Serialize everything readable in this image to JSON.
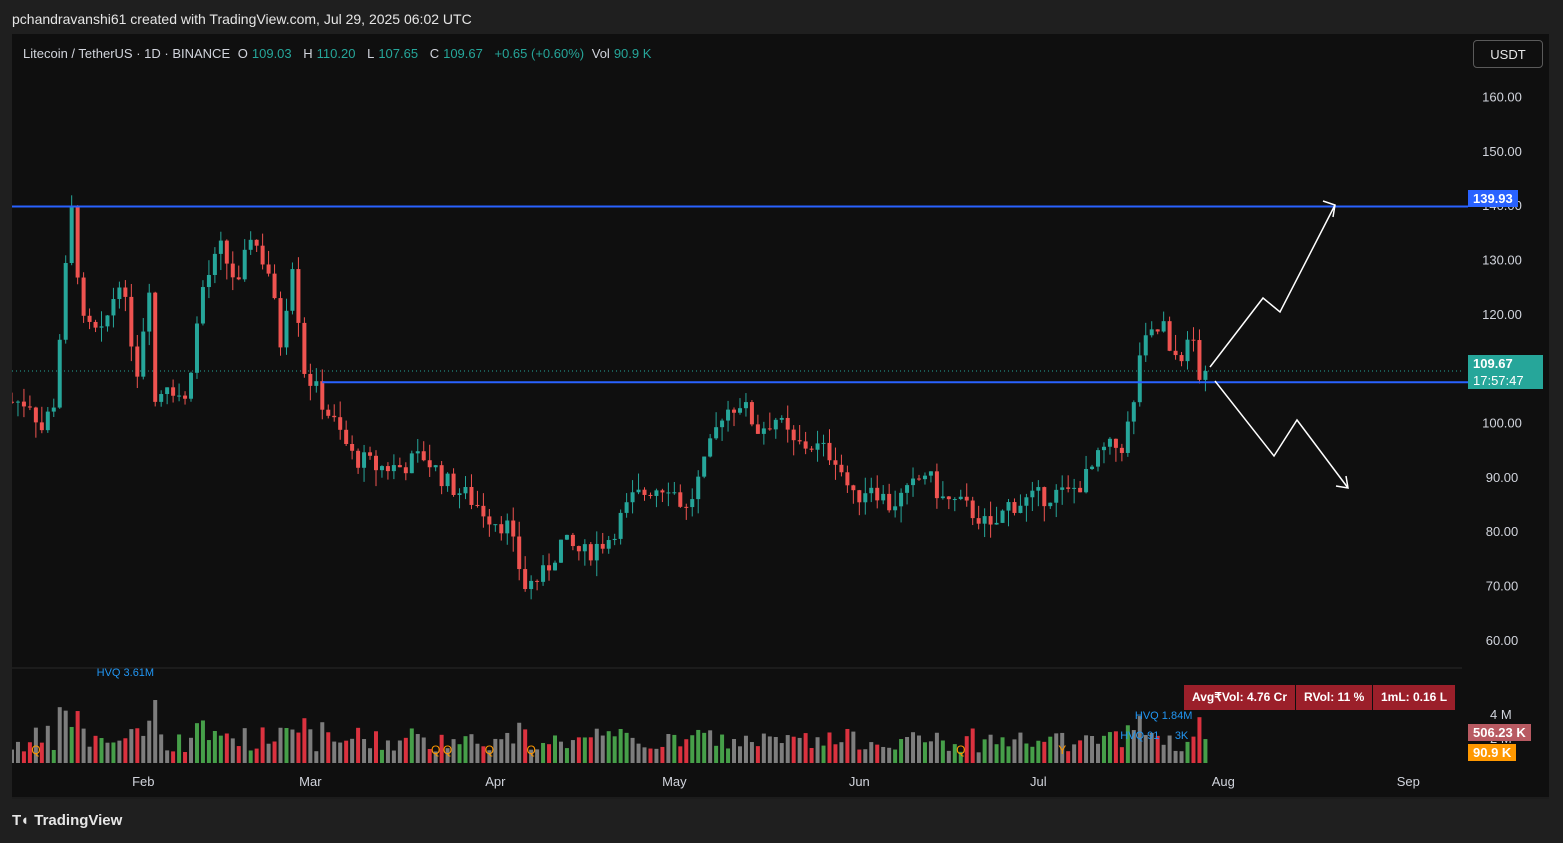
{
  "snapshot": {
    "author_line": "pchandravanshi61 created with TradingView.com, Jul 29, 2025 06:02 UTC"
  },
  "legend": {
    "symbol": "Litecoin / TetherUS · 1D · BINANCE",
    "open_label": "O",
    "open": "109.03",
    "high_label": "H",
    "high": "110.20",
    "low_label": "L",
    "low": "107.65",
    "close_label": "C",
    "close": "109.67",
    "change": "+0.65 (+0.60%)",
    "vol_label": "Vol",
    "vol": "90.9 K"
  },
  "currency": "USDT",
  "price_tags": {
    "resistance": "139.93",
    "last_price": "109.67",
    "countdown": "17:57:47",
    "vol_ma": "506.23 K",
    "vol_current": "90.9 K"
  },
  "volume_stats": {
    "avg_vol": "Avg₹Vol: 4.76 Cr",
    "rvol": "RVol: 11 %",
    "iml": "1mL: 0.16 L"
  },
  "footer": {
    "brand": "TradingView"
  },
  "colors": {
    "up": "#26a69a",
    "down": "#ef5350",
    "level": "#2962ff",
    "vol_up": "#4caf50",
    "vol_down": "#f23645",
    "vol_neutral": "#8a8a8a",
    "vol_hv": "#2196f3",
    "vol_q": "#ff9800"
  },
  "chart_data": {
    "type": "candlestick",
    "y_range": [
      55,
      168
    ],
    "x_range": [
      "2025-01-10",
      "2025-09-10"
    ],
    "y_ticks": [
      "160.00",
      "150.00",
      "140.00",
      "130.00",
      "120.00",
      "110.00",
      "100.00",
      "90.00",
      "80.00",
      "70.00",
      "60.00"
    ],
    "y_tick_values": [
      160,
      150,
      140,
      130,
      120,
      110,
      100,
      90,
      80,
      70,
      60
    ],
    "x_ticks": [
      {
        "label": "Feb",
        "date": "2025-02-01"
      },
      {
        "label": "Mar",
        "date": "2025-03-01"
      },
      {
        "label": "Apr",
        "date": "2025-04-01"
      },
      {
        "label": "May",
        "date": "2025-05-01"
      },
      {
        "label": "Jun",
        "date": "2025-06-01"
      },
      {
        "label": "Jul",
        "date": "2025-07-01"
      },
      {
        "label": "Aug",
        "date": "2025-08-01"
      },
      {
        "label": "Sep",
        "date": "2025-09-01"
      }
    ],
    "volume_axis_ticks": [
      "4 M",
      "2 M"
    ],
    "volume_axis_values": [
      4,
      2
    ],
    "close_path": [
      {
        "date": "2025-01-10",
        "close": 104
      },
      {
        "date": "2025-01-13",
        "close": 104
      },
      {
        "date": "2025-01-15",
        "close": 99
      },
      {
        "date": "2025-01-17",
        "close": 104
      },
      {
        "date": "2025-01-19",
        "close": 128
      },
      {
        "date": "2025-01-20",
        "close": 139
      },
      {
        "date": "2025-01-22",
        "close": 118
      },
      {
        "date": "2025-01-25",
        "close": 116
      },
      {
        "date": "2025-01-28",
        "close": 127
      },
      {
        "date": "2025-01-31",
        "close": 110
      },
      {
        "date": "2025-02-02",
        "close": 126
      },
      {
        "date": "2025-02-03",
        "close": 104
      },
      {
        "date": "2025-02-05",
        "close": 108
      },
      {
        "date": "2025-02-08",
        "close": 104
      },
      {
        "date": "2025-02-11",
        "close": 125
      },
      {
        "date": "2025-02-14",
        "close": 132
      },
      {
        "date": "2025-02-17",
        "close": 125
      },
      {
        "date": "2025-02-19",
        "close": 135
      },
      {
        "date": "2025-02-22",
        "close": 128
      },
      {
        "date": "2025-02-24",
        "close": 115
      },
      {
        "date": "2025-02-26",
        "close": 130
      },
      {
        "date": "2025-02-28",
        "close": 110
      },
      {
        "date": "2025-03-03",
        "close": 104
      },
      {
        "date": "2025-03-05",
        "close": 100
      },
      {
        "date": "2025-03-08",
        "close": 94
      },
      {
        "date": "2025-03-12",
        "close": 92
      },
      {
        "date": "2025-03-16",
        "close": 92
      },
      {
        "date": "2025-03-20",
        "close": 94
      },
      {
        "date": "2025-03-24",
        "close": 89
      },
      {
        "date": "2025-03-28",
        "close": 86
      },
      {
        "date": "2025-03-31",
        "close": 83
      },
      {
        "date": "2025-04-03",
        "close": 81
      },
      {
        "date": "2025-04-06",
        "close": 70
      },
      {
        "date": "2025-04-09",
        "close": 72
      },
      {
        "date": "2025-04-12",
        "close": 78
      },
      {
        "date": "2025-04-16",
        "close": 76
      },
      {
        "date": "2025-04-20",
        "close": 79
      },
      {
        "date": "2025-04-24",
        "close": 86
      },
      {
        "date": "2025-04-27",
        "close": 88
      },
      {
        "date": "2025-04-30",
        "close": 89
      },
      {
        "date": "2025-05-03",
        "close": 84
      },
      {
        "date": "2025-05-06",
        "close": 92
      },
      {
        "date": "2025-05-09",
        "close": 102
      },
      {
        "date": "2025-05-12",
        "close": 104
      },
      {
        "date": "2025-05-15",
        "close": 99
      },
      {
        "date": "2025-05-18",
        "close": 101
      },
      {
        "date": "2025-05-21",
        "close": 96
      },
      {
        "date": "2025-05-24",
        "close": 96
      },
      {
        "date": "2025-05-28",
        "close": 94
      },
      {
        "date": "2025-05-31",
        "close": 86
      },
      {
        "date": "2025-06-03",
        "close": 89
      },
      {
        "date": "2025-06-06",
        "close": 85
      },
      {
        "date": "2025-06-09",
        "close": 87
      },
      {
        "date": "2025-06-12",
        "close": 91
      },
      {
        "date": "2025-06-15",
        "close": 86
      },
      {
        "date": "2025-06-18",
        "close": 85
      },
      {
        "date": "2025-06-21",
        "close": 83
      },
      {
        "date": "2025-06-23",
        "close": 80
      },
      {
        "date": "2025-06-26",
        "close": 85
      },
      {
        "date": "2025-06-30",
        "close": 86
      },
      {
        "date": "2025-07-03",
        "close": 87
      },
      {
        "date": "2025-07-06",
        "close": 87
      },
      {
        "date": "2025-07-09",
        "close": 90
      },
      {
        "date": "2025-07-12",
        "close": 95
      },
      {
        "date": "2025-07-15",
        "close": 96
      },
      {
        "date": "2025-07-17",
        "close": 103
      },
      {
        "date": "2025-07-18",
        "close": 113
      },
      {
        "date": "2025-07-20",
        "close": 116
      },
      {
        "date": "2025-07-22",
        "close": 118
      },
      {
        "date": "2025-07-23",
        "close": 112
      },
      {
        "date": "2025-07-25",
        "close": 113
      },
      {
        "date": "2025-07-26",
        "close": 114
      },
      {
        "date": "2025-07-27",
        "close": 115
      },
      {
        "date": "2025-07-28",
        "close": 109.03
      },
      {
        "date": "2025-07-29",
        "close": 109.67
      }
    ],
    "resistance_level": 139.93,
    "support_level": 107.6,
    "volume_labels": [
      {
        "text": "HVQ 3.61M",
        "date": "2025-01-29"
      },
      {
        "text": "HVQ 1.84M",
        "date": "2025-07-22"
      },
      {
        "text": "HVQ 91",
        "date": "2025-07-18"
      },
      {
        "text": "3K",
        "date": "2025-07-25"
      }
    ],
    "volume_markers": [
      {
        "text": "Q",
        "date": "2025-01-14"
      },
      {
        "text": "Q",
        "date": "2025-03-22"
      },
      {
        "text": "Q",
        "date": "2025-03-24"
      },
      {
        "text": "Q",
        "date": "2025-03-31"
      },
      {
        "text": "Q",
        "date": "2025-04-07"
      },
      {
        "text": "Q",
        "date": "2025-06-18"
      },
      {
        "text": "Y",
        "date": "2025-07-05"
      }
    ]
  }
}
